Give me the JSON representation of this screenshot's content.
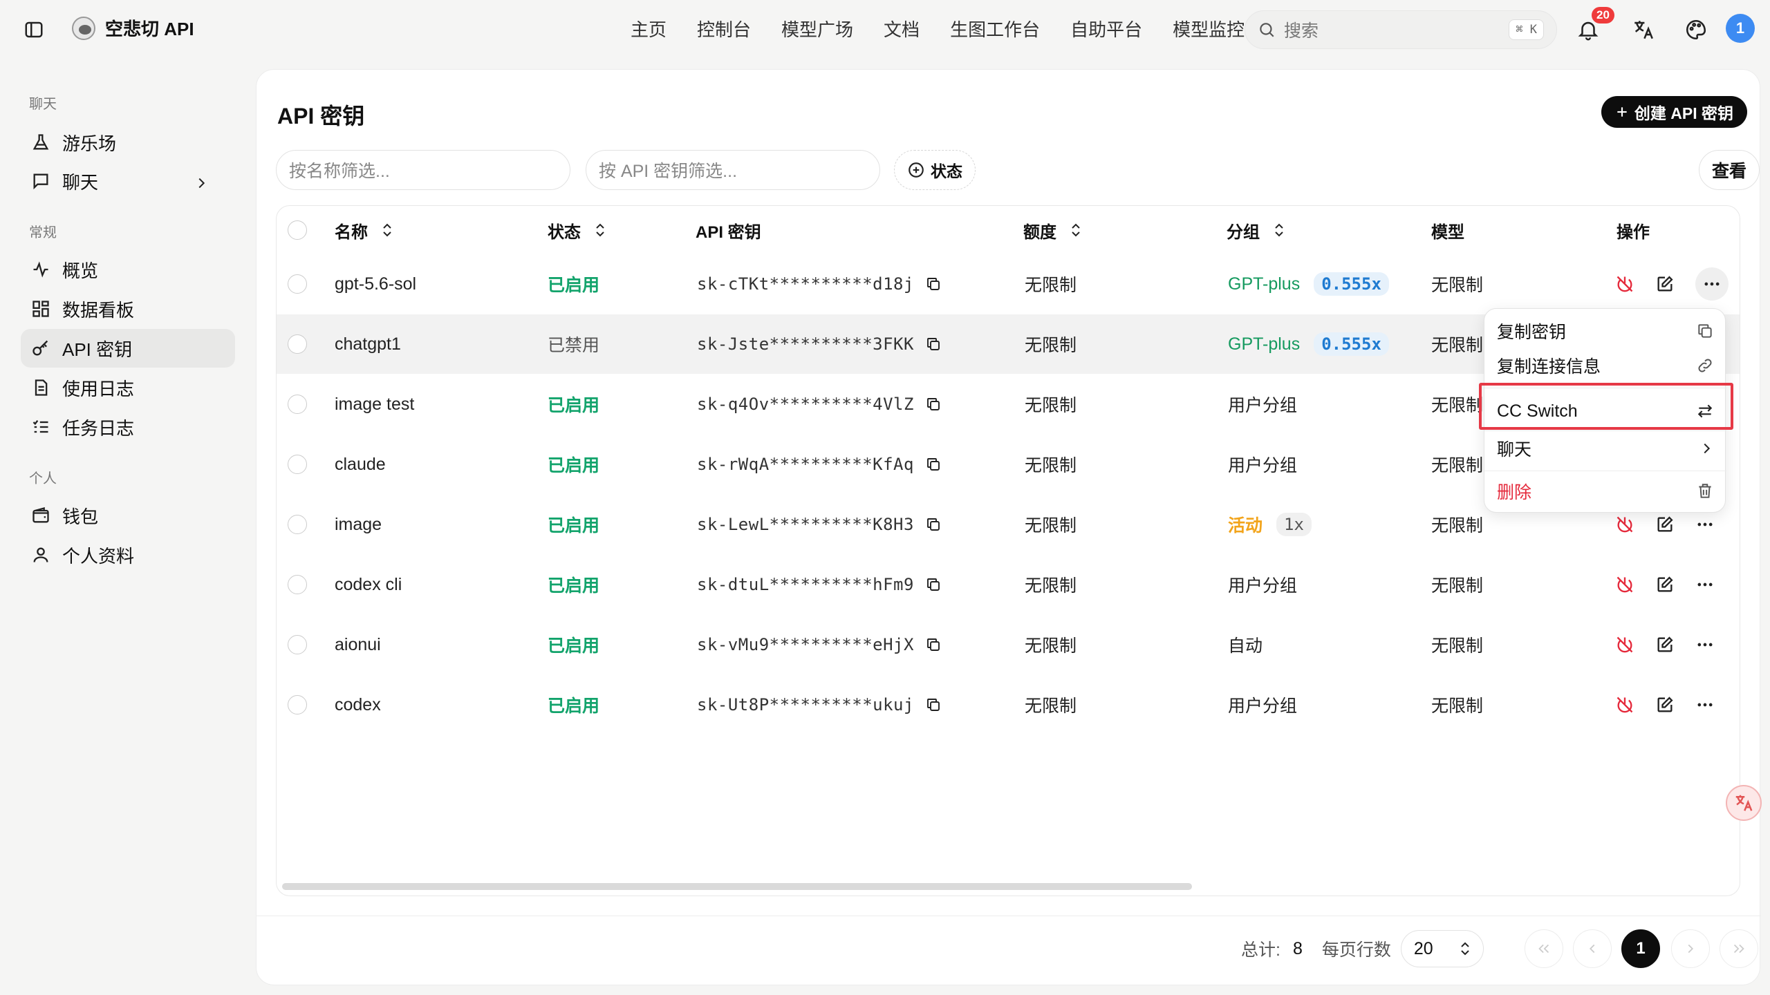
{
  "brand": {
    "name": "空悲切 API"
  },
  "nav": [
    "主页",
    "控制台",
    "模型广场",
    "文档",
    "生图工作台",
    "自助平台",
    "模型监控"
  ],
  "search": {
    "placeholder": "搜索",
    "shortcut": "⌘ K"
  },
  "notifications": {
    "count": "20"
  },
  "user": {
    "avatar_initial": "1"
  },
  "sidebar": {
    "sections": [
      {
        "title": "聊天",
        "items": [
          {
            "label": "游乐场",
            "icon": "flask-icon"
          },
          {
            "label": "聊天",
            "icon": "message-icon"
          }
        ]
      },
      {
        "title": "常规",
        "items": [
          {
            "label": "概览",
            "icon": "activity-icon"
          },
          {
            "label": "数据看板",
            "icon": "dashboard-icon"
          },
          {
            "label": "API 密钥",
            "icon": "key-icon"
          },
          {
            "label": "使用日志",
            "icon": "file-text-icon"
          },
          {
            "label": "任务日志",
            "icon": "list-check-icon"
          }
        ]
      },
      {
        "title": "个人",
        "items": [
          {
            "label": "钱包",
            "icon": "wallet-icon"
          },
          {
            "label": "个人资料",
            "icon": "user-icon"
          }
        ]
      }
    ],
    "active": "API 密钥"
  },
  "page": {
    "title": "API 密钥",
    "create_button": "创建 API 密钥",
    "filter_name_placeholder": "按名称筛选...",
    "filter_key_placeholder": "按 API 密钥筛选...",
    "status_filter": "状态",
    "view_button": "查看"
  },
  "table": {
    "columns": [
      "名称",
      "状态",
      "API 密钥",
      "额度",
      "分组",
      "模型",
      "操作"
    ],
    "rows": [
      {
        "name": "gpt-5.6-sol",
        "status": "已启用",
        "key": "sk-cTKt**********d18j",
        "quota": "无限制",
        "group": "GPT-plus",
        "ratio": "0.555x",
        "model": "无限制"
      },
      {
        "name": "chatgpt1",
        "status": "已禁用",
        "key": "sk-Jste**********3FKK",
        "quota": "无限制",
        "group": "GPT-plus",
        "ratio": "0.555x",
        "model": "无限制"
      },
      {
        "name": "image test",
        "status": "已启用",
        "key": "sk-q4Ov**********4VlZ",
        "quota": "无限制",
        "group": "用户分组",
        "ratio": "",
        "model": "无限制"
      },
      {
        "name": "claude",
        "status": "已启用",
        "key": "sk-rWqA**********KfAq",
        "quota": "无限制",
        "group": "用户分组",
        "ratio": "",
        "model": "无限制"
      },
      {
        "name": "image",
        "status": "已启用",
        "key": "sk-LewL**********K8H3",
        "quota": "无限制",
        "group": "活动",
        "ratio": "1x",
        "model": "无限制"
      },
      {
        "name": "codex cli",
        "status": "已启用",
        "key": "sk-dtuL**********hFm9",
        "quota": "无限制",
        "group": "用户分组",
        "ratio": "",
        "model": "无限制"
      },
      {
        "name": "aionui",
        "status": "已启用",
        "key": "sk-vMu9**********eHjX",
        "quota": "无限制",
        "group": "自动",
        "ratio": "",
        "model": "无限制"
      },
      {
        "name": "codex",
        "status": "已启用",
        "key": "sk-Ut8P**********ukuj",
        "quota": "无限制",
        "group": "用户分组",
        "ratio": "",
        "model": "无限制"
      }
    ]
  },
  "menu": {
    "items": [
      {
        "label": "复制密钥",
        "icon": "copy-icon"
      },
      {
        "label": "复制连接信息",
        "icon": "link-icon"
      },
      {
        "label": "CC Switch",
        "icon": "arrows-swap-icon"
      },
      {
        "label": "聊天",
        "icon": "chevron-right-icon"
      },
      {
        "label": "删除",
        "icon": "trash-icon"
      }
    ]
  },
  "pagination": {
    "total_label": "总计:",
    "total": "8",
    "per_page_label": "每页行数",
    "per_page": "20",
    "current_page": "1"
  },
  "colors": {
    "enabled": "#12a36b",
    "group_plus": "#159a5f",
    "group_event": "#f2a41b",
    "danger": "#e5293b",
    "highlight": "#e63946"
  }
}
